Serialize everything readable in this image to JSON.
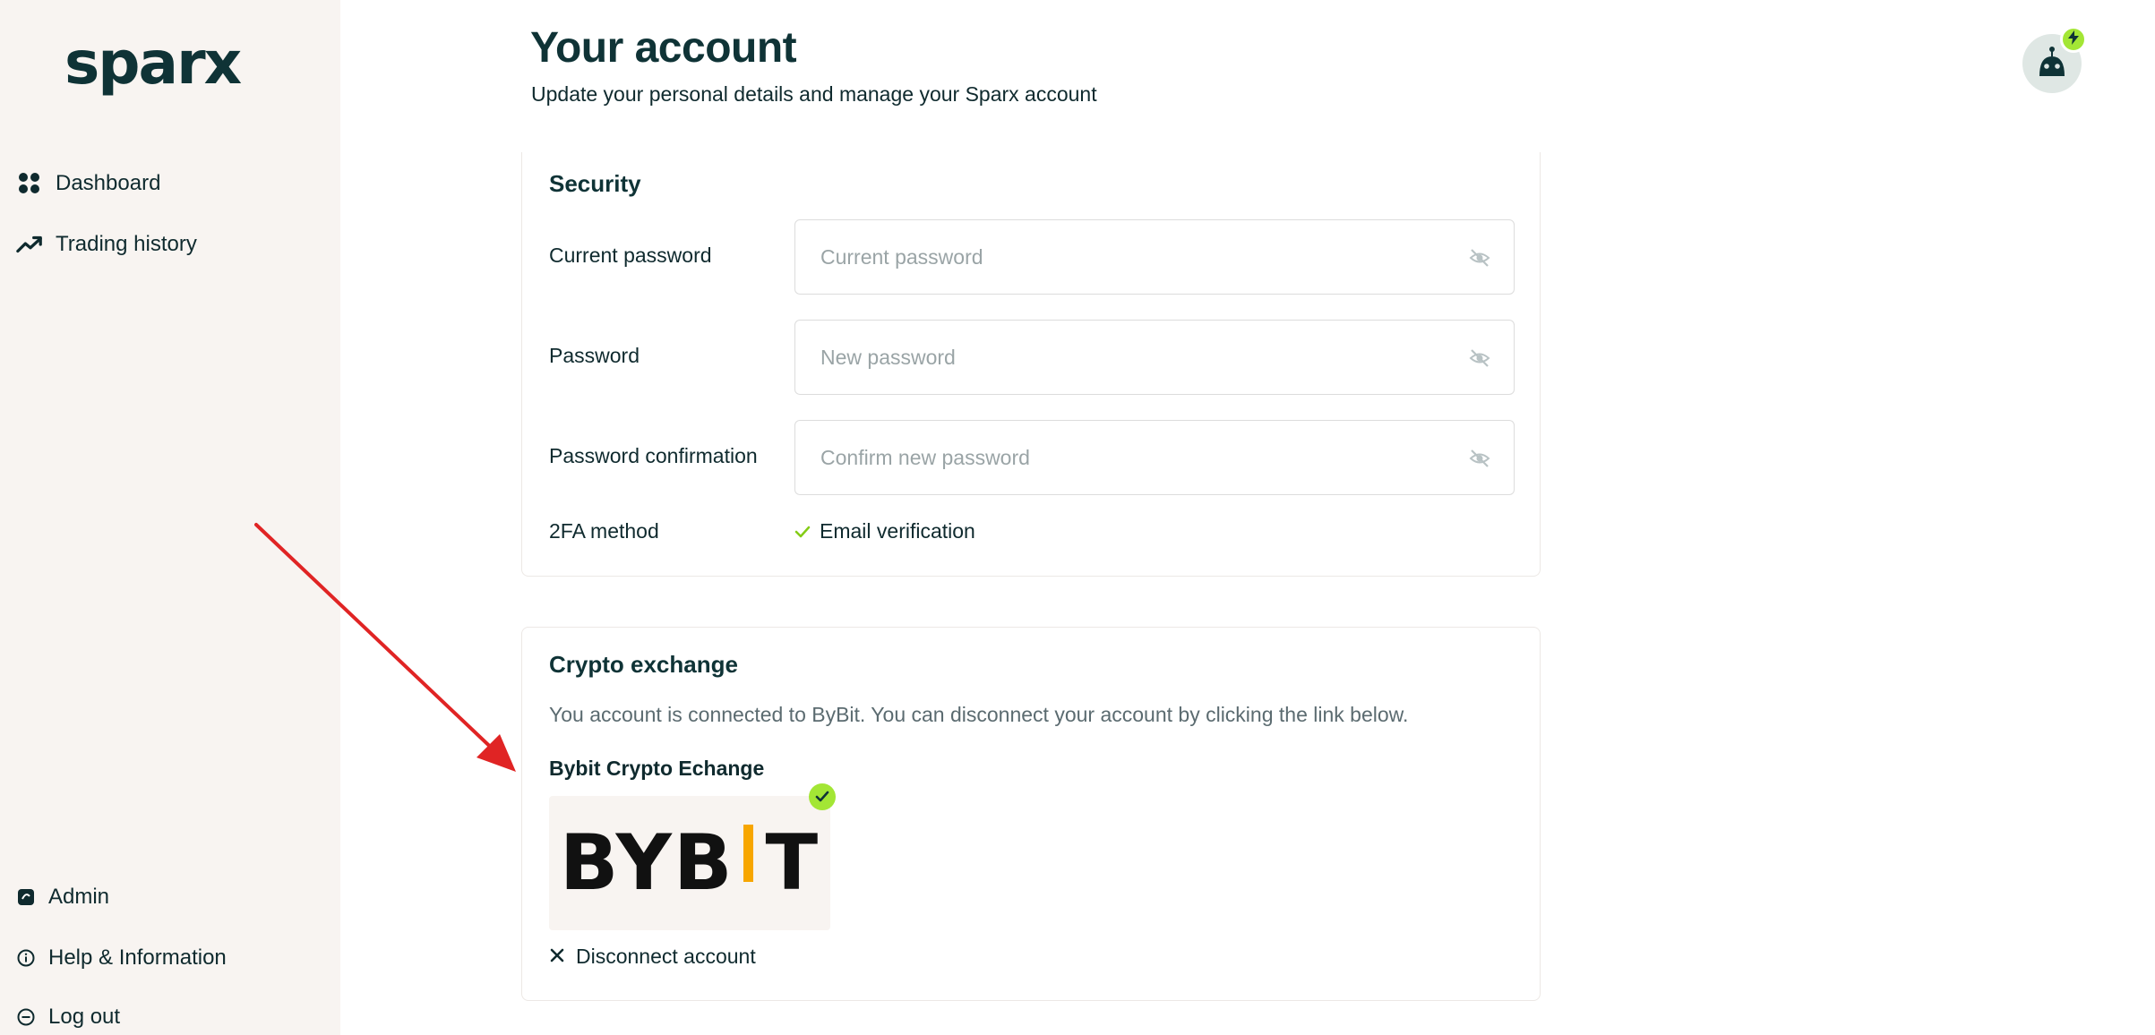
{
  "brand": {
    "logo_text": "sparx"
  },
  "sidebar": {
    "items": [
      {
        "label": "Dashboard",
        "icon": "dashboard-grid-icon"
      },
      {
        "label": "Trading history",
        "icon": "trending-up-icon"
      }
    ],
    "bottom_items": [
      {
        "label": "Admin",
        "icon": "admin-icon"
      },
      {
        "label": "Help & Information",
        "icon": "info-icon"
      },
      {
        "label": "Log out",
        "icon": "logout-icon"
      }
    ]
  },
  "header": {
    "title": "Your account",
    "subtitle": "Update your personal details and manage your Sparx account"
  },
  "user": {
    "avatar_icon": "robot-icon",
    "badge_icon": "lightning-icon"
  },
  "security": {
    "title": "Security",
    "fields": [
      {
        "label": "Current password",
        "placeholder": "Current password"
      },
      {
        "label": "Password",
        "placeholder": "New password"
      },
      {
        "label": "Password confirmation",
        "placeholder": "Confirm new password"
      }
    ],
    "twofa": {
      "label": "2FA method",
      "value": "Email verification"
    }
  },
  "crypto": {
    "title": "Crypto exchange",
    "description": "You account is connected to ByBit. You can disconnect your account by clicking the link below.",
    "exchange_name": "Bybit Crypto Echange",
    "exchange_logo": {
      "left": "BYB",
      "right": "T"
    },
    "disconnect_label": "Disconnect account"
  },
  "colors": {
    "brand_dark": "#0f3336",
    "accent_green": "#a3e635",
    "sidebar_bg": "#f8f4f1",
    "bybit_orange": "#f7a600",
    "annotation_red": "#e02424"
  }
}
